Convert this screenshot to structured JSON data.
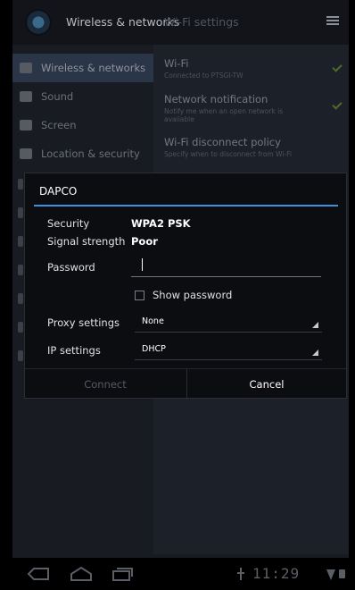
{
  "actionbar": {
    "title": "Wireless & networks",
    "subtitle": "Wi-Fi settings"
  },
  "sidebar": {
    "items": [
      {
        "label": "Wireless & networks",
        "icon": "wifi-icon",
        "active": true
      },
      {
        "label": "Sound",
        "icon": "speaker-icon",
        "active": false
      },
      {
        "label": "Screen",
        "icon": "brightness-icon",
        "active": false
      },
      {
        "label": "Location & security",
        "icon": "grid-lock-icon",
        "active": false
      }
    ]
  },
  "settings": {
    "wifi_title": "Wi-Fi",
    "wifi_summary": "Connected to PTSGI-TW",
    "notify_title": "Network notification",
    "notify_summary": "Notify me when an open network is available",
    "policy_title": "Wi-Fi disconnect policy",
    "policy_summary": "Specify when to disconnect from Wi-Fi"
  },
  "dialog": {
    "title": "DAPCO",
    "security_label": "Security",
    "security_value": "WPA2 PSK",
    "signal_label": "Signal strength",
    "signal_value": "Poor",
    "password_label": "Password",
    "password_value": "",
    "show_password_label": "Show password",
    "proxy_label": "Proxy settings",
    "proxy_value": "None",
    "ip_label": "IP settings",
    "ip_value": "DHCP",
    "connect_label": "Connect",
    "cancel_label": "Cancel"
  },
  "navbar": {
    "clock": "11:29"
  },
  "colors": {
    "accent": "#3b8fe0",
    "dialog_bg": "#0c0d10"
  }
}
